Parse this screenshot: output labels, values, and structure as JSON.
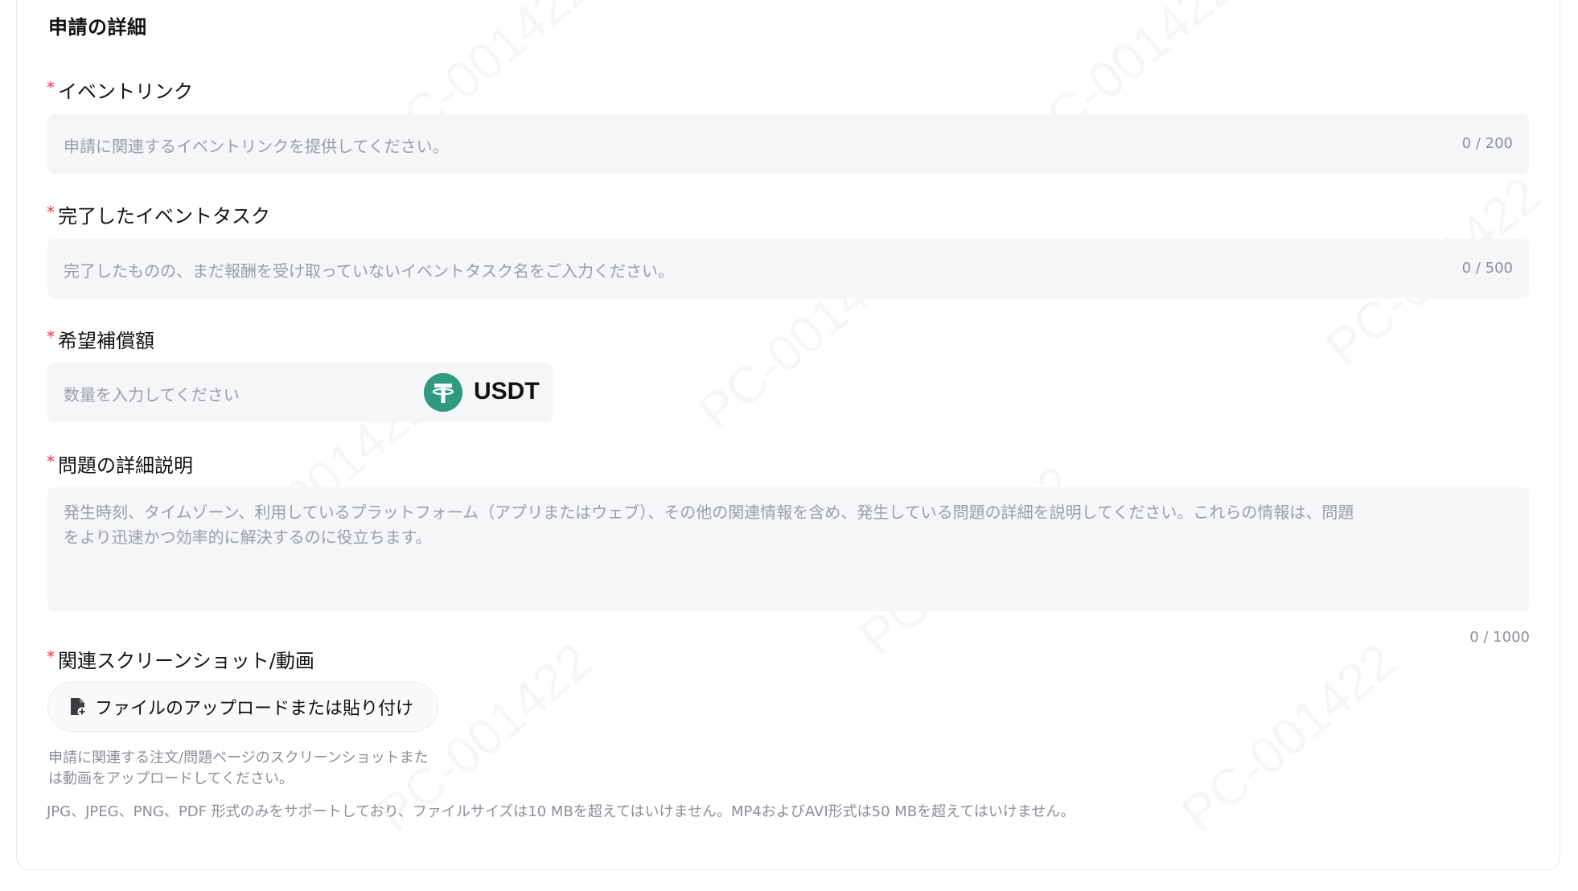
{
  "section": {
    "title": "申請の詳細"
  },
  "fields": {
    "event_link": {
      "label": "イベントリンク",
      "placeholder": "申請に関連するイベントリンクを提供してください。",
      "counter": "0 / 200"
    },
    "event_task": {
      "label": "完了したイベントタスク",
      "placeholder": "完了したものの、まだ報酬を受け取っていないイベントタスク名をご入力ください。",
      "counter": "0 / 500"
    },
    "amount": {
      "label": "希望補償額",
      "placeholder": "数量を入力してください",
      "currency": "USDT",
      "currency_icon": "tether-icon",
      "currency_color": "#2f9a7e"
    },
    "description": {
      "label": "問題の詳細説明",
      "placeholder_line1": "発生時刻、タイムゾーン、利用しているプラットフォーム（アプリまたはウェブ）、その他の関連情報を含め、発生している問題の詳細を説明してください。これらの情報は、問題",
      "placeholder_line2": "をより迅速かつ効率的に解決するのに役立ちます。",
      "counter": "0 / 1000"
    },
    "attachments": {
      "label": "関連スクリーンショット/動画",
      "upload_label": "ファイルのアップロードまたは貼り付け",
      "upload_icon": "file-upload-icon",
      "hint_line1": "申請に関連する注文/問題ページのスクリーンショットまた",
      "hint_line2": "は動画をアップロードしてください。",
      "format_note": "JPG、JPEG、PNG、PDF 形式のみをサポートしており、ファイルサイズは10 MBを超えてはいけません。MP4およびAVI形式は50 MBを超えてはいけません。"
    }
  },
  "required_marker": "*",
  "watermark_text": "PC-001422",
  "colors": {
    "required": "#f23051",
    "input_bg": "#f5f6f8",
    "placeholder": "#9a9ea6"
  }
}
